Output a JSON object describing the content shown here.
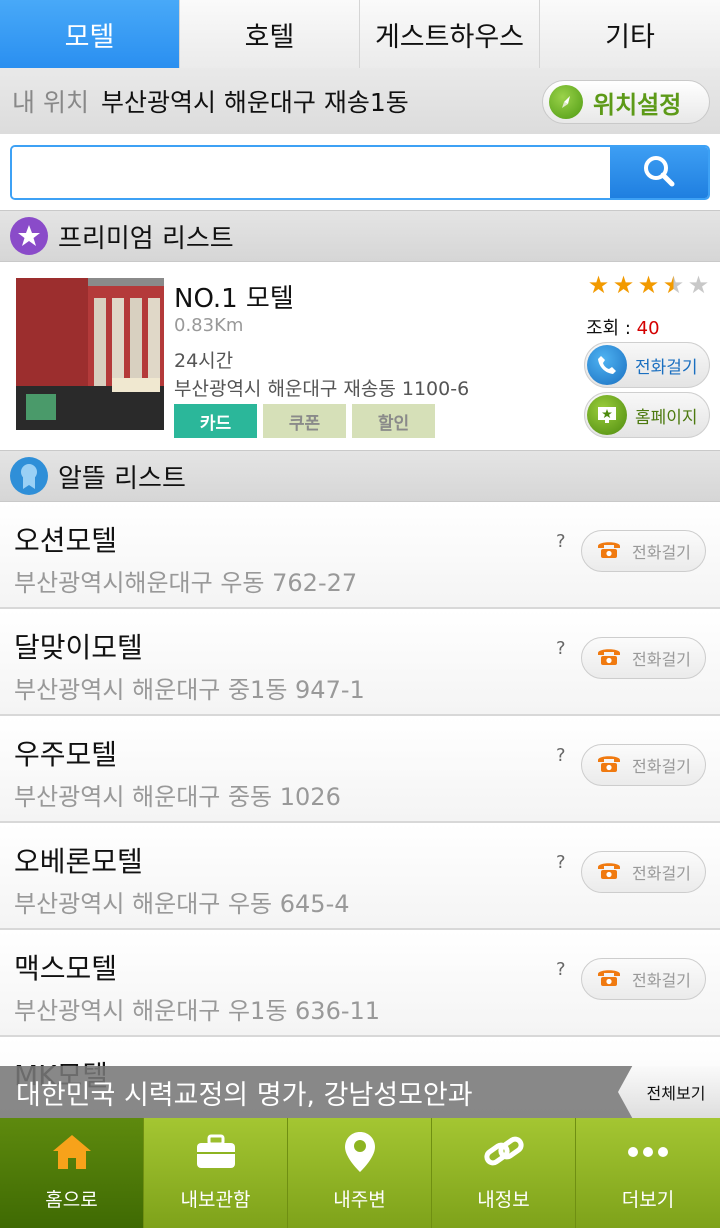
{
  "tabs": [
    {
      "label": "모텔",
      "active": true
    },
    {
      "label": "호텔",
      "active": false
    },
    {
      "label": "게스트하우스",
      "active": false
    },
    {
      "label": "기타",
      "active": false
    }
  ],
  "location": {
    "label": "내 위치",
    "value": "부산광역시 해운대구 재송1동",
    "button_label": "위치설정",
    "button_icon": "compass-icon"
  },
  "search": {
    "placeholder": "",
    "value": "",
    "button_icon": "search-icon"
  },
  "premium": {
    "title": "프리미엄 리스트",
    "item": {
      "name": "NO.1 모텔",
      "distance": "0.83Km",
      "hours": "24시간",
      "address": "부산광역시 해운대구 재송동 1100-6",
      "tags": [
        "카드",
        "쿠폰",
        "할인"
      ],
      "rating": 3.5,
      "rating_max": 5,
      "views_label": "조회 :",
      "views": "40",
      "call_label": "전화걸기",
      "homepage_label": "홈페이지"
    }
  },
  "budget": {
    "title": "알뜰 리스트",
    "items": [
      {
        "name": "오션모텔",
        "address": "부산광역시해운대구 우동 762-27",
        "mark": "?",
        "call_label": "전화걸기"
      },
      {
        "name": "달맞이모텔",
        "address": "부산광역시 해운대구 중1동 947-1",
        "mark": "?",
        "call_label": "전화걸기"
      },
      {
        "name": "우주모텔",
        "address": "부산광역시 해운대구 중동 1026",
        "mark": "?",
        "call_label": "전화걸기"
      },
      {
        "name": "오베론모텔",
        "address": "부산광역시 해운대구 우동 645-4",
        "mark": "?",
        "call_label": "전화걸기"
      },
      {
        "name": "맥스모텔",
        "address": "부산광역시 해운대구 우1동 636-11",
        "mark": "?",
        "call_label": "전화걸기"
      },
      {
        "name": "MK모텔",
        "address": "",
        "mark": "",
        "call_label": ""
      }
    ]
  },
  "banner": {
    "text": "대한민국 시력교정의 명가, 강남성모안과",
    "button_label": "전체보기"
  },
  "bottom_nav": [
    {
      "label": "홈으로",
      "icon": "home-icon",
      "active": true
    },
    {
      "label": "내보관함",
      "icon": "briefcase-icon",
      "active": false
    },
    {
      "label": "내주변",
      "icon": "map-pin-icon",
      "active": false
    },
    {
      "label": "내정보",
      "icon": "link-icon",
      "active": false
    },
    {
      "label": "더보기",
      "icon": "more-icon",
      "active": false
    }
  ],
  "colors": {
    "accent_blue": "#2a8ff0",
    "nav_green": "#8db421",
    "tag_active": "#2bb79a",
    "tag_inactive": "#d6e0b8"
  }
}
